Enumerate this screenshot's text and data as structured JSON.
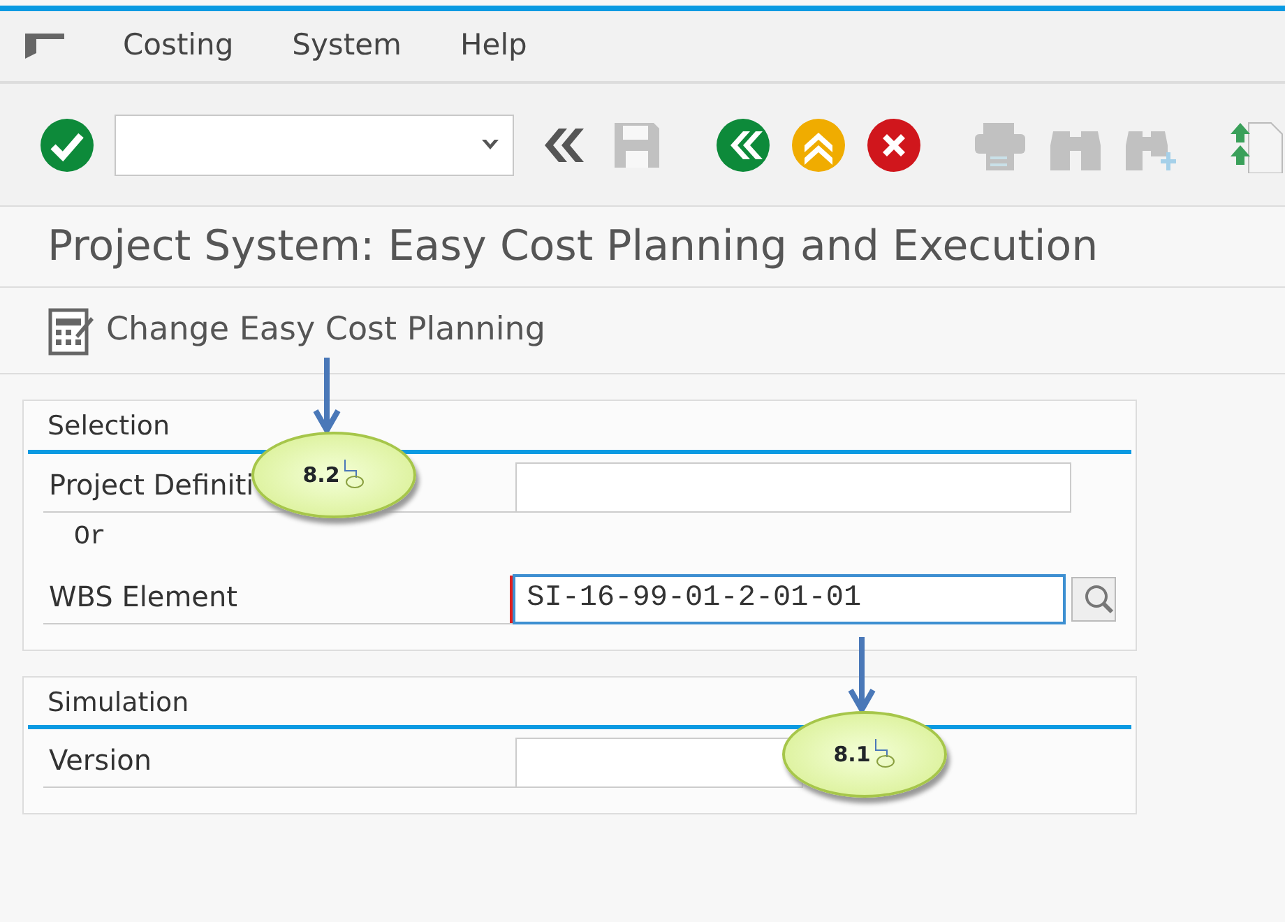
{
  "menu": [
    {
      "label": "Costing"
    },
    {
      "label": "System"
    },
    {
      "label": "Help"
    }
  ],
  "toolbar": [
    {
      "kind": "enter",
      "disabled": false
    },
    {
      "kind": "command"
    },
    {
      "kind": "collapse",
      "disabled": false
    },
    {
      "kind": "save",
      "disabled": true
    },
    {
      "kind": "back",
      "disabled": false
    },
    {
      "kind": "exit",
      "disabled": false
    },
    {
      "kind": "cancel",
      "disabled": false
    },
    {
      "kind": "print",
      "disabled": true
    },
    {
      "kind": "find",
      "disabled": true
    },
    {
      "kind": "findnext",
      "disabled": true
    },
    {
      "kind": "firstpage",
      "disabled": false
    }
  ],
  "title": "Project System: Easy Cost Planning and Execution",
  "app_toolbar": {
    "label": "Change Easy Cost Planning"
  },
  "groups": [
    {
      "title": "Selection",
      "fields": [
        {
          "kind": "field",
          "label": "Project Definiti"
        },
        {
          "kind": "text",
          "label": "Or"
        },
        {
          "kind": "field",
          "label": "WBS Element",
          "value": "SI-16-99-01-2-01-01",
          "focused": true,
          "search_help": true
        }
      ]
    },
    {
      "title": "Simulation",
      "fields": [
        {
          "kind": "field",
          "label": "Version"
        }
      ]
    }
  ],
  "callouts": [
    {
      "label": "8.2"
    },
    {
      "label": "8.1"
    }
  ]
}
